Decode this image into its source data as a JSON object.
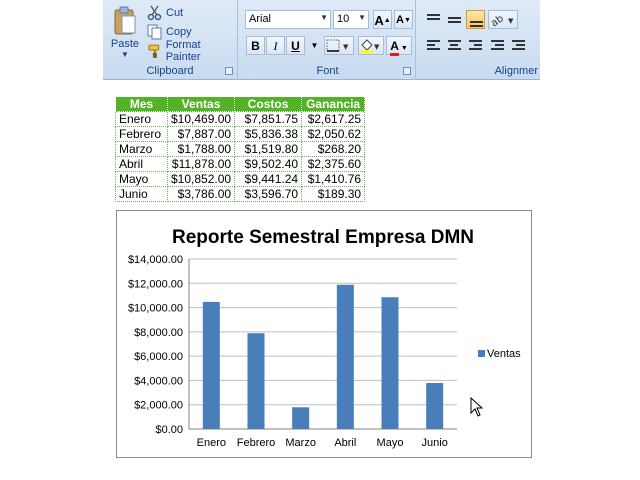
{
  "ribbon": {
    "clipboard": {
      "paste_label": "Paste",
      "cut_label": "Cut",
      "copy_label": "Copy",
      "format_painter_label": "Format Painter",
      "group_label": "Clipboard"
    },
    "font": {
      "font_name": "Arial",
      "font_size": "10",
      "bold_label": "B",
      "italic_label": "I",
      "underline_label": "U",
      "grow_font_label": "A",
      "shrink_font_label": "A",
      "font_color_label": "A",
      "group_label": "Font",
      "font_color": "#e02020"
    },
    "alignment": {
      "group_label": "Alignmer"
    }
  },
  "table": {
    "headers": [
      "Mes",
      "Ventas",
      "Costos",
      "Ganancia"
    ],
    "rows": [
      [
        "Enero",
        "$10,469.00",
        "$7,851.75",
        "$2,617.25"
      ],
      [
        "Febrero",
        "$7,887.00",
        "$5,836.38",
        "$2,050.62"
      ],
      [
        "Marzo",
        "$1,788.00",
        "$1,519.80",
        "$268.20"
      ],
      [
        "Abril",
        "$11,878.00",
        "$9,502.40",
        "$2,375.60"
      ],
      [
        "Mayo",
        "$10,852.00",
        "$9,441.24",
        "$1,410.76"
      ],
      [
        "Junio",
        "$3,786.00",
        "$3,596.70",
        "$189.30"
      ]
    ],
    "header_color": "#52b327"
  },
  "chart_data": {
    "type": "bar",
    "title": "Reporte Semestral Empresa DMN",
    "categories": [
      "Enero",
      "Febrero",
      "Marzo",
      "Abril",
      "Mayo",
      "Junio"
    ],
    "series": [
      {
        "name": "Ventas",
        "values": [
          10469,
          7887,
          1788,
          11878,
          10852,
          3786
        ],
        "color": "#4a7ebb"
      }
    ],
    "y_ticks": [
      "$0.00",
      "$2,000.00",
      "$4,000.00",
      "$6,000.00",
      "$8,000.00",
      "$10,000.00",
      "$12,000.00",
      "$14,000.00"
    ],
    "ylim": [
      0,
      14000
    ],
    "grid": true,
    "legend_position": "right"
  }
}
